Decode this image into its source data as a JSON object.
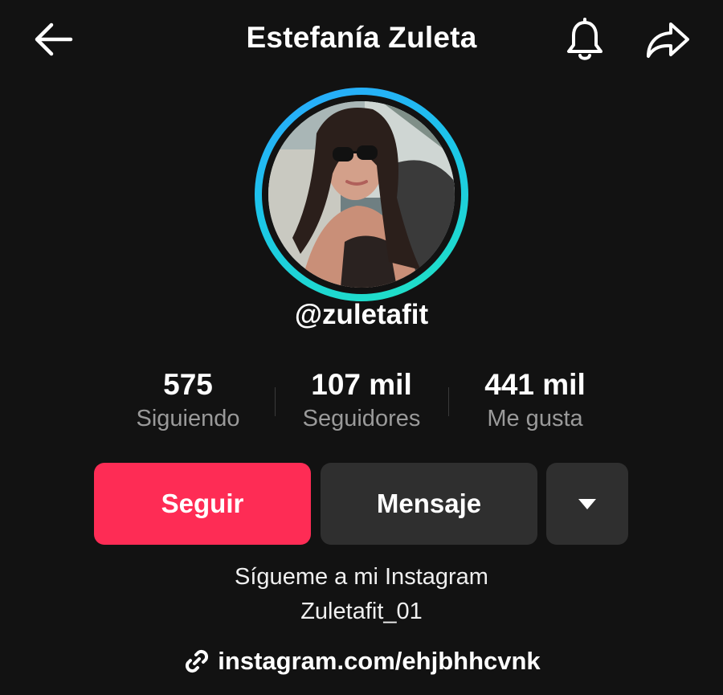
{
  "header": {
    "title": "Estefanía Zuleta",
    "icons": {
      "back": "arrow-left-icon",
      "notifications": "bell-icon",
      "share": "share-arrow-icon"
    }
  },
  "profile": {
    "username": "@zuletafit",
    "avatar": {
      "ring_colors": [
        "#2aa6ff",
        "#20e3c2"
      ]
    }
  },
  "stats": [
    {
      "value": "575",
      "label": "Siguiendo"
    },
    {
      "value": "107 mil",
      "label": "Seguidores"
    },
    {
      "value": "441 mil",
      "label": "Me gusta"
    }
  ],
  "actions": {
    "follow_label": "Seguir",
    "message_label": "Mensaje",
    "more_icon": "caret-down-icon"
  },
  "bio": {
    "line1": "Sígueme a mi Instagram",
    "line2": "Zuletafit_01",
    "link": "instagram.com/ehjbhhcvnk",
    "link_icon": "link-icon"
  },
  "colors": {
    "background": "#121212",
    "follow_button": "#fe2c55",
    "secondary_button": "#2f2f2f",
    "muted_text": "#9a9a9a"
  }
}
